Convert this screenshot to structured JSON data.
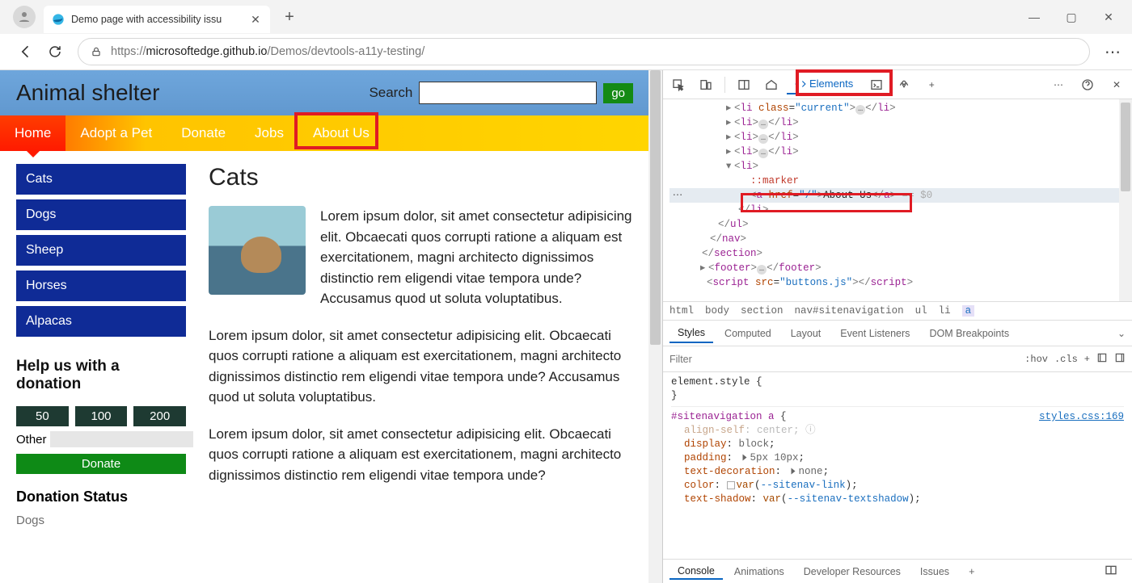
{
  "browser": {
    "tab_title": "Demo page with accessibility issu",
    "url_prefix": "https://",
    "url_host": "microsoftedge.github.io",
    "url_path": "/Demos/devtools-a11y-testing/"
  },
  "site": {
    "title": "Animal shelter",
    "search_label": "Search",
    "go": "go",
    "nav": {
      "home": "Home",
      "adopt": "Adopt a Pet",
      "donate": "Donate",
      "jobs": "Jobs",
      "about": "About Us"
    },
    "side": {
      "cats": "Cats",
      "dogs": "Dogs",
      "sheep": "Sheep",
      "horses": "Horses",
      "alpacas": "Alpacas"
    },
    "help_heading": "Help us with a donation",
    "d50": "50",
    "d100": "100",
    "d200": "200",
    "other": "Other",
    "donate_btn": "Donate",
    "dstat_h": "Donation Status",
    "dstat_dogs": "Dogs",
    "cats_h": "Cats",
    "p1": "Lorem ipsum dolor, sit amet consectetur adipisicing elit. Obcaecati quos corrupti ratione a aliquam est exercitationem, magni architecto dignissimos distinctio rem eligendi vitae tempora unde? Accusamus quod ut soluta voluptatibus.",
    "p2": "Lorem ipsum dolor, sit amet consectetur adipisicing elit. Obcaecati quos corrupti ratione a aliquam est exercitationem, magni architecto dignissimos distinctio rem eligendi vitae tempora unde? Accusamus quod ut soluta voluptatibus.",
    "p3": "Lorem ipsum dolor, sit amet consectetur adipisicing elit. Obcaecati quos corrupti ratione a aliquam est exercitationem, magni architecto dignissimos distinctio rem eligendi vitae tempora unde?"
  },
  "devtools": {
    "tabs": {
      "elements": "Elements"
    },
    "dom": {
      "li_current": "<li class=\"current\">…</li>",
      "li_dots": "<li>…</li>",
      "li_open": "<li>",
      "marker": "::marker",
      "a": "<a href=\"/\">About Us</a>",
      "eq": " == $0",
      "li_close": "</li>",
      "ul_close": "</ul>",
      "nav_close": "</nav>",
      "section_close": "</section>",
      "footer": "<footer>…</footer>",
      "script": "<script src=\"buttons.js\"></scr"
    },
    "crumbs": {
      "html": "html",
      "body": "body",
      "section": "section",
      "nav": "nav#sitenavigation",
      "ul": "ul",
      "li": "li",
      "a": "a"
    },
    "styles_tabs": {
      "styles": "Styles",
      "computed": "Computed",
      "layout": "Layout",
      "ev": "Event Listeners",
      "dom": "DOM Breakpoints"
    },
    "filter_placeholder": "Filter",
    "hov": ":hov",
    "cls": ".cls",
    "element_style": "element.style {",
    "close_brace": "}",
    "rule_sel": "#sitenavigation a {",
    "rule_src": "styles.css:169",
    "align": "align-self: center;",
    "display": "display: block;",
    "padding": "padding: ",
    "padding_v": "5px 10px;",
    "textdec": "text-decoration: ",
    "textdec_v": "none;",
    "color": "color: ",
    "color_v": "var(--sitenav-link);",
    "tshadow": "text-shadow: var(--sitenav-textshadow);",
    "drawer": {
      "console": "Console",
      "anim": "Animations",
      "dev": "Developer Resources",
      "issues": "Issues"
    }
  }
}
